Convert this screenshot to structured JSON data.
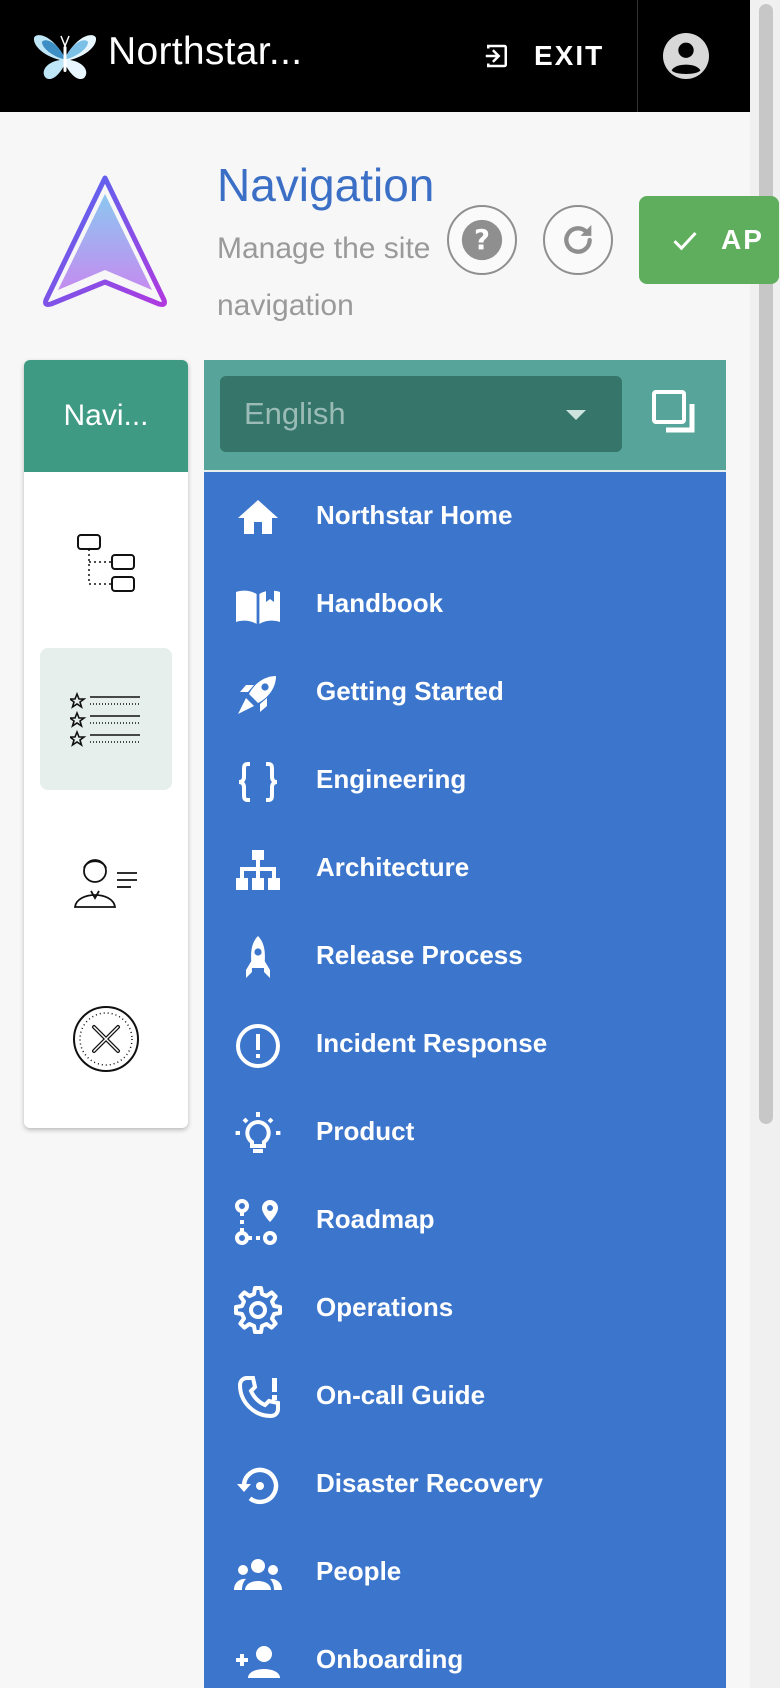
{
  "header": {
    "app_title": "Northstar...",
    "exit_label": "EXIT",
    "icons": [
      "butterfly-logo",
      "exit-icon",
      "account-icon"
    ]
  },
  "page": {
    "title": "Navigation",
    "subtitle": "Manage the site navigation",
    "apply_label": "AP",
    "icons": [
      "navigation-arrow-logo",
      "help-icon",
      "reload-icon",
      "check-icon"
    ]
  },
  "left_panel": {
    "header_label": "Navi...",
    "tools": [
      {
        "name": "tree-view-tool",
        "active": false
      },
      {
        "name": "starred-list-tool",
        "active": true
      },
      {
        "name": "user-profile-tool",
        "active": false
      },
      {
        "name": "close-tool",
        "active": false
      }
    ]
  },
  "menu_panel": {
    "language": "English",
    "items": [
      {
        "label": "Northstar Home",
        "icon": "home-icon"
      },
      {
        "label": "Handbook",
        "icon": "book-icon"
      },
      {
        "label": "Getting Started",
        "icon": "rocket-launch-icon"
      },
      {
        "label": "Engineering",
        "icon": "code-braces-icon"
      },
      {
        "label": "Architecture",
        "icon": "sitemap-icon"
      },
      {
        "label": "Release Process",
        "icon": "rocket-icon"
      },
      {
        "label": "Incident Response",
        "icon": "alert-circle-icon"
      },
      {
        "label": "Product",
        "icon": "lightbulb-icon"
      },
      {
        "label": "Roadmap",
        "icon": "map-marker-path-icon"
      },
      {
        "label": "Operations",
        "icon": "gear-icon"
      },
      {
        "label": "On-call Guide",
        "icon": "phone-alert-icon"
      },
      {
        "label": "Disaster Recovery",
        "icon": "restore-icon"
      },
      {
        "label": "People",
        "icon": "people-icon"
      },
      {
        "label": "Onboarding",
        "icon": "add-person-icon"
      }
    ]
  },
  "colors": {
    "topbar": "#000000",
    "accent_blue": "#3b75cc",
    "teal": "#3f9a84",
    "apply_green": "#5fae5d"
  }
}
